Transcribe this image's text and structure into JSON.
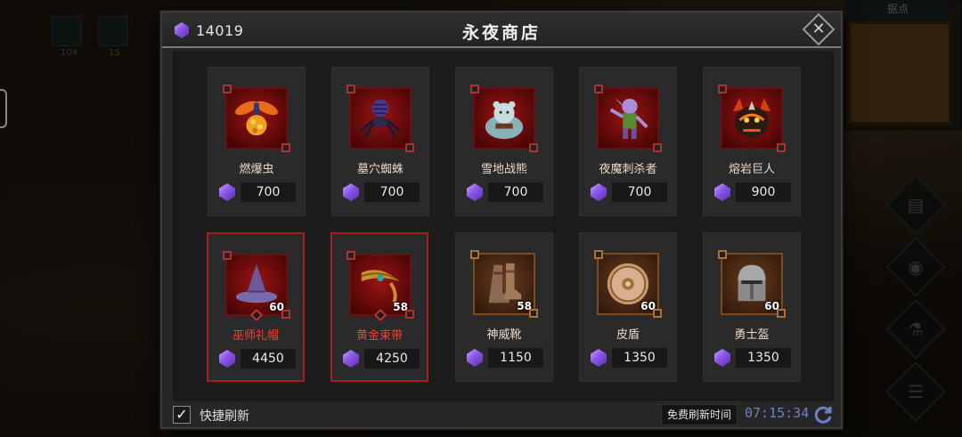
{
  "shop": {
    "title": "永夜商店",
    "currency_amount": "14019",
    "currency_icon": "purple-gem-icon"
  },
  "background": {
    "minimap_title": "据点",
    "skill_counts": [
      "104",
      "15"
    ]
  },
  "items_row1": [
    {
      "name": "燃爆虫",
      "price": "700",
      "icon": "fire-bug-icon"
    },
    {
      "name": "墓穴蜘蛛",
      "price": "700",
      "icon": "tomb-spider-icon"
    },
    {
      "name": "雪地战熊",
      "price": "700",
      "icon": "snow-bear-icon"
    },
    {
      "name": "夜魔刺杀者",
      "price": "700",
      "icon": "night-assassin-icon"
    },
    {
      "name": "熔岩巨人",
      "price": "900",
      "icon": "lava-giant-icon"
    }
  ],
  "items_row2": [
    {
      "name": "巫师礼帽",
      "price": "4450",
      "level": "60",
      "icon": "wizard-hat-icon"
    },
    {
      "name": "黄金束带",
      "price": "4250",
      "level": "58",
      "icon": "golden-belt-icon"
    },
    {
      "name": "神威靴",
      "price": "1150",
      "level": "58",
      "icon": "boots-icon"
    },
    {
      "name": "皮盾",
      "price": "1350",
      "level": "60",
      "icon": "leather-shield-icon"
    },
    {
      "name": "勇士盔",
      "price": "1350",
      "level": "60",
      "icon": "warrior-helmet-icon"
    }
  ],
  "footer": {
    "quick_refresh_label": "快捷刷新",
    "quick_refresh_checked": true,
    "free_refresh_label": "免费刷新时间",
    "timer": "07:15:34"
  },
  "colors": {
    "accent_red": "#ff3b30",
    "gem_purple": "#8a55e8",
    "timer_blue": "#6f7fc8"
  }
}
